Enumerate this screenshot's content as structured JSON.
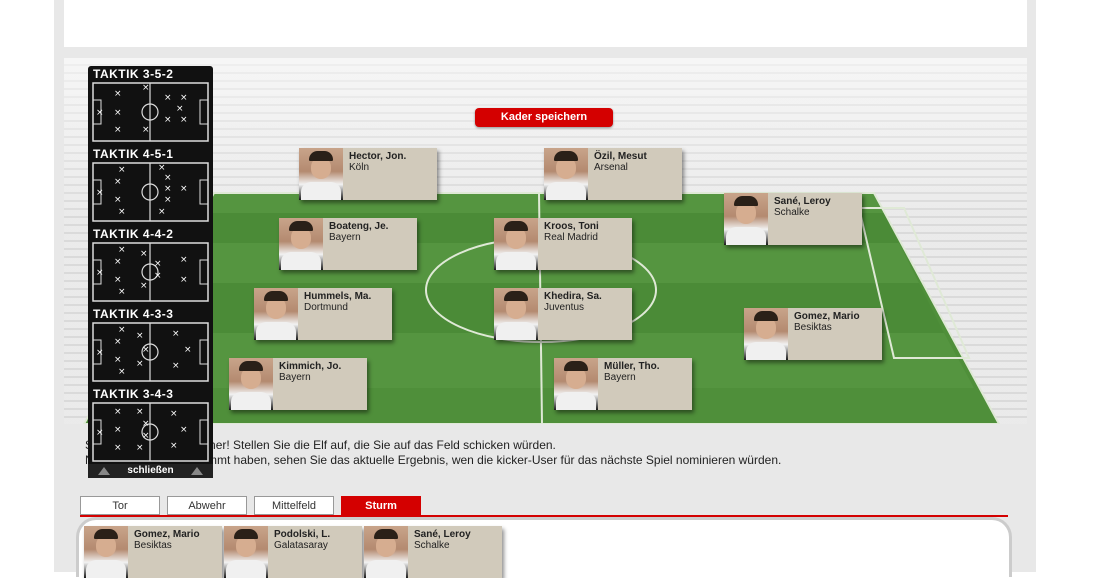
{
  "stadium": {
    "save_button": "Kader speichern"
  },
  "lineup": [
    {
      "name": "Hector, Jon.",
      "club": "Köln"
    },
    {
      "name": "Özil, Mesut",
      "club": "Arsenal"
    },
    {
      "name": "Sané, Leroy",
      "club": "Schalke"
    },
    {
      "name": "Boateng, Je.",
      "club": "Bayern"
    },
    {
      "name": "Kroos, Toni",
      "club": "Real Madrid"
    },
    {
      "name": "Hummels, Ma.",
      "club": "Dortmund"
    },
    {
      "name": "Khedira, Sa.",
      "club": "Juventus"
    },
    {
      "name": "Gomez, Mario",
      "club": "Besiktas"
    },
    {
      "name": "Kimmich, Jo.",
      "club": "Bayern"
    },
    {
      "name": "Müller, Tho.",
      "club": "Bayern"
    }
  ],
  "tactics": {
    "items": [
      {
        "label": "TAKTIK 3-5-2"
      },
      {
        "label": "TAKTIK 4-5-1"
      },
      {
        "label": "TAKTIK 4-4-2"
      },
      {
        "label": "TAKTIK 4-3-3"
      },
      {
        "label": "TAKTIK 3-4-3"
      }
    ],
    "close_label": "schließen"
  },
  "intro": {
    "line1": "S                                  iner! Stellen Sie die Elf auf, die Sie auf das Feld schicken würden.",
    "line2": "N                                  mmt haben, sehen Sie das aktuelle Ergebnis, wen die kicker-User für das nächste Spiel nominieren würden."
  },
  "tabs": [
    {
      "label": "Tor"
    },
    {
      "label": "Abwehr"
    },
    {
      "label": "Mittelfeld"
    },
    {
      "label": "Sturm"
    }
  ],
  "active_tab": "Sturm",
  "pool": [
    {
      "name": "Gomez, Mario",
      "club": "Besiktas"
    },
    {
      "name": "Podolski, L.",
      "club": "Galatasaray"
    },
    {
      "name": "Sané, Leroy",
      "club": "Schalke"
    }
  ],
  "colors": {
    "accent": "#d40000",
    "pitch": "#4f8f3a",
    "card": "#d1cabb"
  }
}
